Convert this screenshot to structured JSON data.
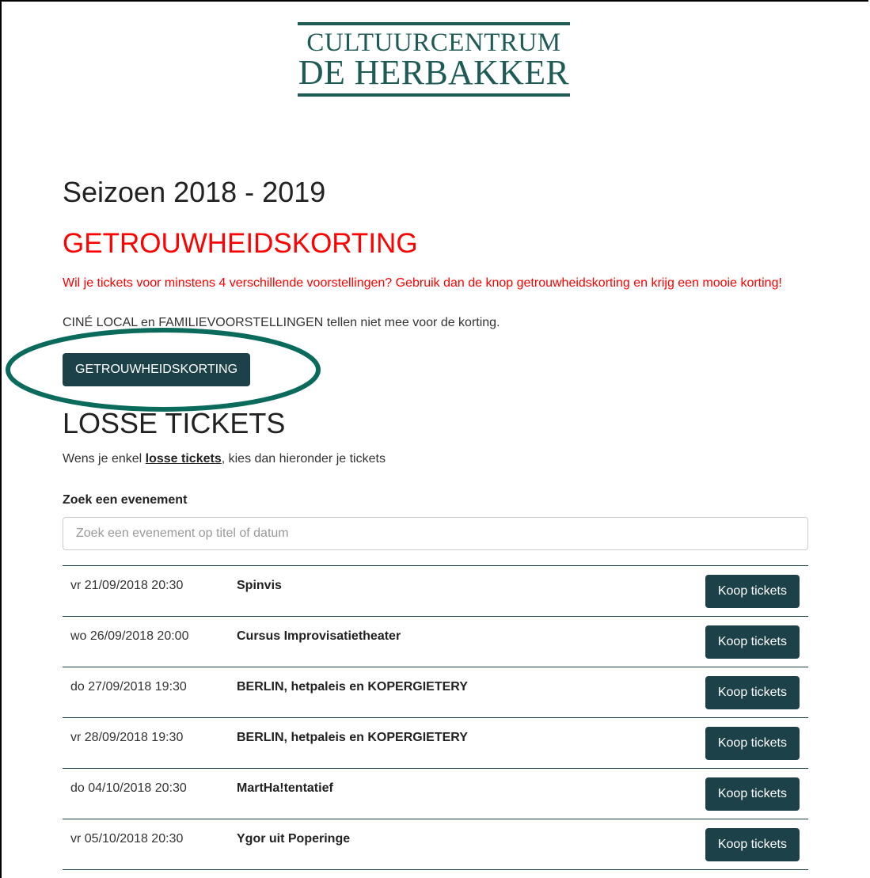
{
  "logo": {
    "line1": "CULTUURCENTRUM",
    "line2": "DE HERBAKKER",
    "color": "#1f5b55"
  },
  "season": {
    "title": "Seizoen 2018 - 2019"
  },
  "loyalty": {
    "title": "GETROUWHEIDSKORTING",
    "description": "Wil je tickets voor minstens 4 verschillende voorstellingen? Gebruik dan de knop getrouwheidskorting en krijg een mooie korting!",
    "note": "CINÉ LOCAL en FAMILIEVOORSTELLINGEN tellen niet mee voor de korting.",
    "button_label": "GETROUWHEIDSKORTING",
    "highlight_color": "#0a6b5c"
  },
  "single_tickets": {
    "title": "LOSSE TICKETS",
    "desc_before": "Wens je enkel ",
    "desc_link": "losse tickets",
    "desc_after": ", kies dan hieronder je tickets"
  },
  "search": {
    "label": "Zoek een evenement",
    "placeholder": "Zoek een evenement op titel of datum",
    "value": ""
  },
  "events": [
    {
      "date": "vr 21/09/2018 20:30",
      "title": "Spinvis",
      "button": "Koop tickets"
    },
    {
      "date": "wo 26/09/2018 20:00",
      "title": "Cursus Improvisatietheater",
      "button": "Koop tickets"
    },
    {
      "date": "do 27/09/2018 19:30",
      "title": "BERLIN, hetpaleis en KOPERGIETERY",
      "button": "Koop tickets"
    },
    {
      "date": "vr 28/09/2018 19:30",
      "title": "BERLIN, hetpaleis en KOPERGIETERY",
      "button": "Koop tickets"
    },
    {
      "date": "do 04/10/2018 20:30",
      "title": "MartHa!tentatief",
      "button": "Koop tickets"
    },
    {
      "date": "vr 05/10/2018 20:30",
      "title": "Ygor uit Poperinge",
      "button": "Koop tickets"
    }
  ],
  "colors": {
    "accent": "#1d4148",
    "alert": "#ff0000"
  }
}
